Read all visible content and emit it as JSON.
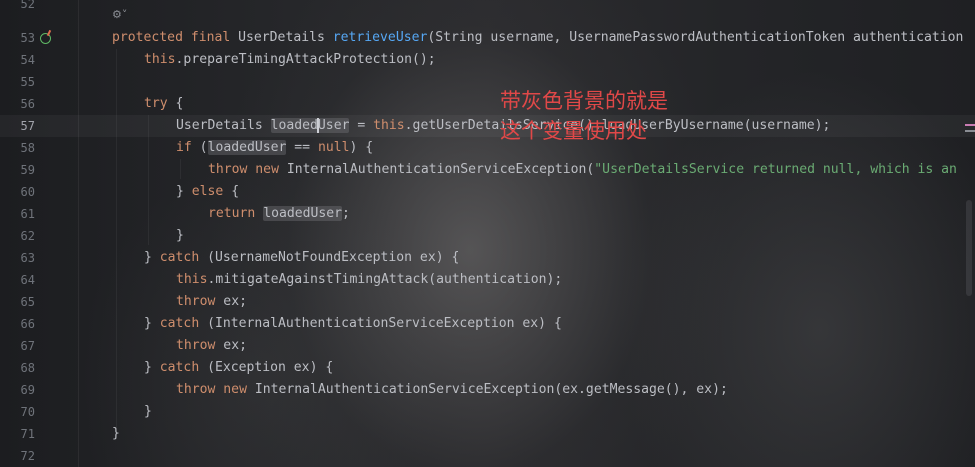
{
  "editor": {
    "line_numbers": [
      "52",
      "53",
      "54",
      "55",
      "56",
      "57",
      "58",
      "59",
      "60",
      "61",
      "62",
      "63",
      "64",
      "65",
      "66",
      "67",
      "68",
      "69",
      "70",
      "71",
      "72"
    ],
    "current_line": "57",
    "inlay_hint": "⚙˅",
    "annotation": {
      "line1": "带灰色背景的就是",
      "line2": "这个变量使用处"
    },
    "code": {
      "l53": {
        "kw1": "protected final ",
        "type": "UserDetails ",
        "method": "retrieveUser",
        "rest": "(String username, UsernamePasswordAuthenticationToken authentication"
      },
      "l54": {
        "kw": "this",
        "rest": ".prepareTimingAttackProtection();"
      },
      "l56": {
        "kw": "try",
        "rest": " {"
      },
      "l57": {
        "pre": "UserDetails ",
        "var_a": "loaded",
        "var_b": "User",
        "mid": " = ",
        "kw": "this",
        "rest": ".getUserDetailsService().loadUserByUsername(username);"
      },
      "l58": {
        "kw": "if",
        "p1": " (",
        "var": "loadedUser",
        "p2": " == ",
        "kw2": "null",
        "p3": ") {"
      },
      "l59": {
        "kw": "throw new ",
        "cls": "InternalAuthenticationServiceException(",
        "str": "\"UserDetailsService returned null, which is an"
      },
      "l60": {
        "p1": "} ",
        "kw": "else",
        "p2": " {"
      },
      "l61": {
        "kw": "return ",
        "var": "loadedUser",
        "p": ";"
      },
      "l62": {
        "p": "}"
      },
      "l63": {
        "p1": "} ",
        "kw": "catch",
        "p2": " (UsernameNotFoundException ex) {"
      },
      "l64": {
        "kw": "this",
        "rest": ".mitigateAgainstTimingAttack(authentication);"
      },
      "l65": {
        "kw": "throw",
        "rest": " ex;"
      },
      "l66": {
        "p1": "} ",
        "kw": "catch",
        "p2": " (InternalAuthenticationServiceException ex) {"
      },
      "l67": {
        "kw": "throw",
        "rest": " ex;"
      },
      "l68": {
        "p1": "} ",
        "kw": "catch",
        "p2": " (Exception ex) {"
      },
      "l69": {
        "kw": "throw new ",
        "rest": "InternalAuthenticationServiceException(ex.getMessage(), ex);"
      },
      "l70": {
        "p": "}"
      },
      "l71": {
        "p": "}"
      }
    }
  },
  "colors": {
    "keyword": "#cf8e6d",
    "method": "#56a8f5",
    "string": "#6aab73",
    "text": "#bcbec4",
    "annotation": "#e04848",
    "usage_highlight": "#78787d"
  }
}
